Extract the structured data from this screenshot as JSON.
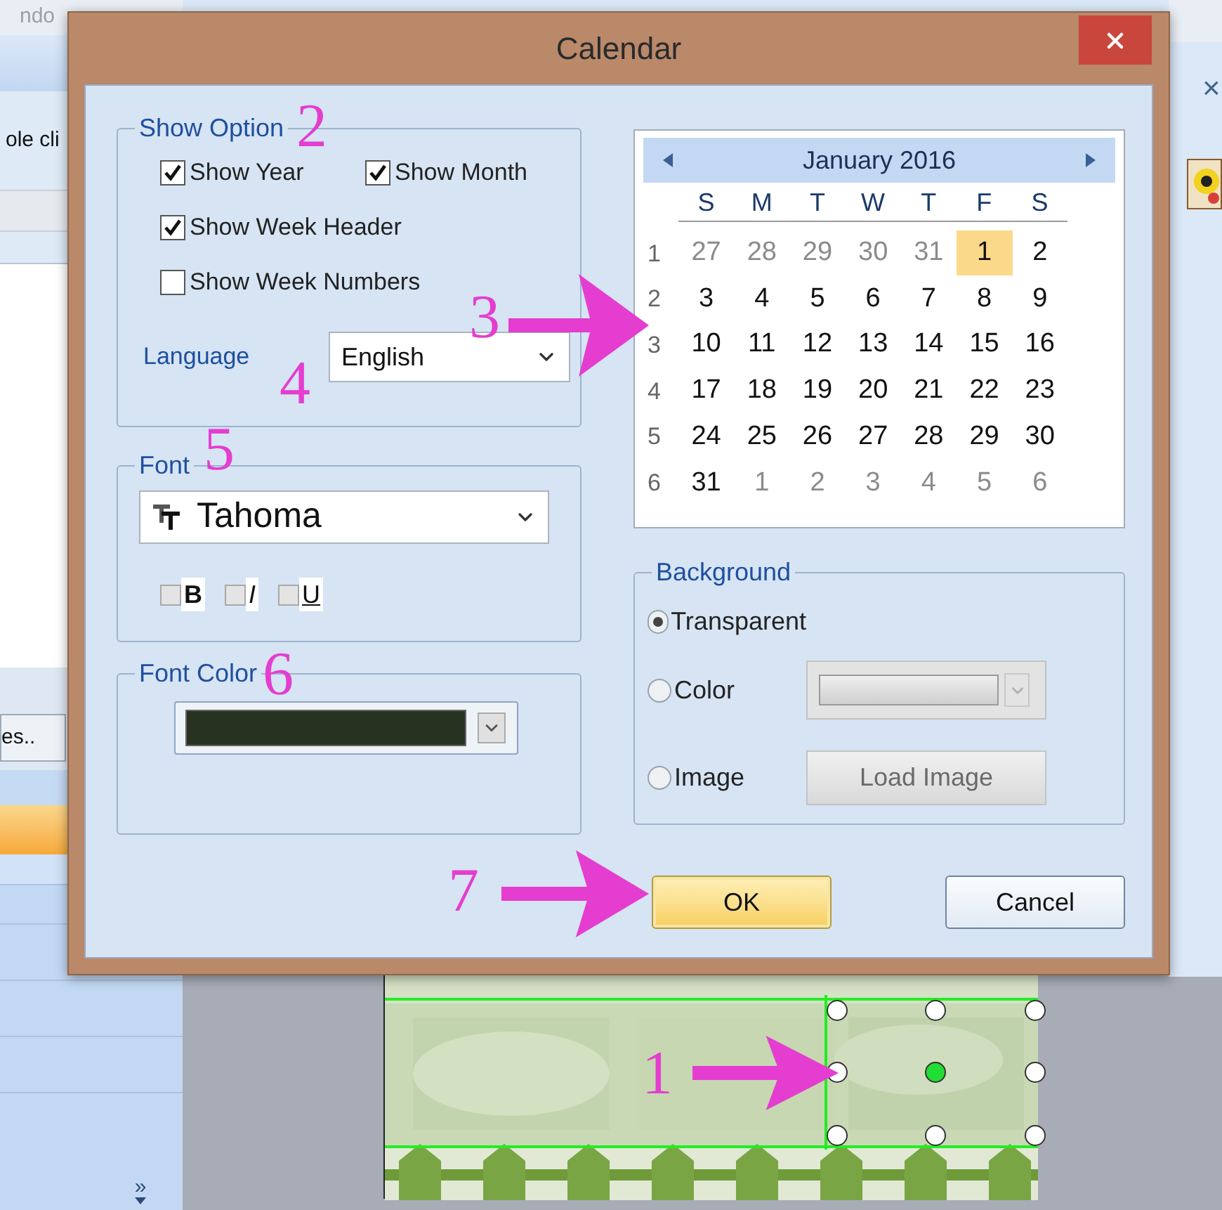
{
  "background_app": {
    "title_fragment": "ndo",
    "row_text": "ole cli",
    "side_button": "es..",
    "close_glyph": "×",
    "more_glyph": "»"
  },
  "dialog": {
    "title": "Calendar"
  },
  "show_option": {
    "title": "Show Option",
    "rows": [
      [
        {
          "label": "Show Year",
          "checked": true
        },
        {
          "label": "Show Month",
          "checked": true
        }
      ],
      [
        {
          "label": "Show Week Header",
          "checked": true
        }
      ],
      [
        {
          "label": "Show Week Numbers",
          "checked": false
        }
      ]
    ],
    "language_label": "Language",
    "language_value": "English"
  },
  "font": {
    "title": "Font",
    "family": "Tahoma",
    "styles": [
      {
        "label": "B",
        "kind": "bold",
        "checked": false
      },
      {
        "label": "I",
        "kind": "italic",
        "checked": false
      },
      {
        "label": "U",
        "kind": "underline",
        "checked": false
      }
    ]
  },
  "font_color": {
    "title": "Font Color",
    "color": "#283220"
  },
  "calendar": {
    "month": "January 2016",
    "day_names": [
      "S",
      "M",
      "T",
      "W",
      "T",
      "F",
      "S"
    ],
    "weeks": [
      {
        "number": "1",
        "days": [
          {
            "day": "27",
            "muted": true,
            "selected": false
          },
          {
            "day": "28",
            "muted": true,
            "selected": false
          },
          {
            "day": "29",
            "muted": true,
            "selected": false
          },
          {
            "day": "30",
            "muted": true,
            "selected": false
          },
          {
            "day": "31",
            "muted": true,
            "selected": false
          },
          {
            "day": "1",
            "muted": false,
            "selected": true
          },
          {
            "day": "2",
            "muted": false,
            "selected": false
          }
        ]
      },
      {
        "number": "2",
        "days": [
          {
            "day": "3",
            "muted": false,
            "selected": false
          },
          {
            "day": "4",
            "muted": false,
            "selected": false
          },
          {
            "day": "5",
            "muted": false,
            "selected": false
          },
          {
            "day": "6",
            "muted": false,
            "selected": false
          },
          {
            "day": "7",
            "muted": false,
            "selected": false
          },
          {
            "day": "8",
            "muted": false,
            "selected": false
          },
          {
            "day": "9",
            "muted": false,
            "selected": false
          }
        ]
      },
      {
        "number": "3",
        "days": [
          {
            "day": "10",
            "muted": false,
            "selected": false
          },
          {
            "day": "11",
            "muted": false,
            "selected": false
          },
          {
            "day": "12",
            "muted": false,
            "selected": false
          },
          {
            "day": "13",
            "muted": false,
            "selected": false
          },
          {
            "day": "14",
            "muted": false,
            "selected": false
          },
          {
            "day": "15",
            "muted": false,
            "selected": false
          },
          {
            "day": "16",
            "muted": false,
            "selected": false
          }
        ]
      },
      {
        "number": "4",
        "days": [
          {
            "day": "17",
            "muted": false,
            "selected": false
          },
          {
            "day": "18",
            "muted": false,
            "selected": false
          },
          {
            "day": "19",
            "muted": false,
            "selected": false
          },
          {
            "day": "20",
            "muted": false,
            "selected": false
          },
          {
            "day": "21",
            "muted": false,
            "selected": false
          },
          {
            "day": "22",
            "muted": false,
            "selected": false
          },
          {
            "day": "23",
            "muted": false,
            "selected": false
          }
        ]
      },
      {
        "number": "5",
        "days": [
          {
            "day": "24",
            "muted": false,
            "selected": false
          },
          {
            "day": "25",
            "muted": false,
            "selected": false
          },
          {
            "day": "26",
            "muted": false,
            "selected": false
          },
          {
            "day": "27",
            "muted": false,
            "selected": false
          },
          {
            "day": "28",
            "muted": false,
            "selected": false
          },
          {
            "day": "29",
            "muted": false,
            "selected": false
          },
          {
            "day": "30",
            "muted": false,
            "selected": false
          }
        ]
      },
      {
        "number": "6",
        "days": [
          {
            "day": "31",
            "muted": false,
            "selected": false
          },
          {
            "day": "1",
            "muted": true,
            "selected": false
          },
          {
            "day": "2",
            "muted": true,
            "selected": false
          },
          {
            "day": "3",
            "muted": true,
            "selected": false
          },
          {
            "day": "4",
            "muted": true,
            "selected": false
          },
          {
            "day": "5",
            "muted": true,
            "selected": false
          },
          {
            "day": "6",
            "muted": true,
            "selected": false
          }
        ]
      }
    ]
  },
  "background": {
    "title": "Background",
    "options": [
      {
        "label": "Transparent",
        "selected": true
      },
      {
        "label": "Color",
        "selected": false
      },
      {
        "label": "Image",
        "selected": false
      }
    ],
    "color_dropdown": {
      "disabled": true
    },
    "load_button": {
      "label": "Load Image",
      "disabled": true
    }
  },
  "buttons": [
    {
      "label": "OK",
      "focused": true
    },
    {
      "label": "Cancel",
      "focused": false
    }
  ],
  "annotations": [
    {
      "label": "2"
    },
    {
      "label": "3"
    },
    {
      "label": "4"
    },
    {
      "label": "5"
    },
    {
      "label": "6"
    },
    {
      "label": "7"
    },
    {
      "label": "1"
    }
  ]
}
